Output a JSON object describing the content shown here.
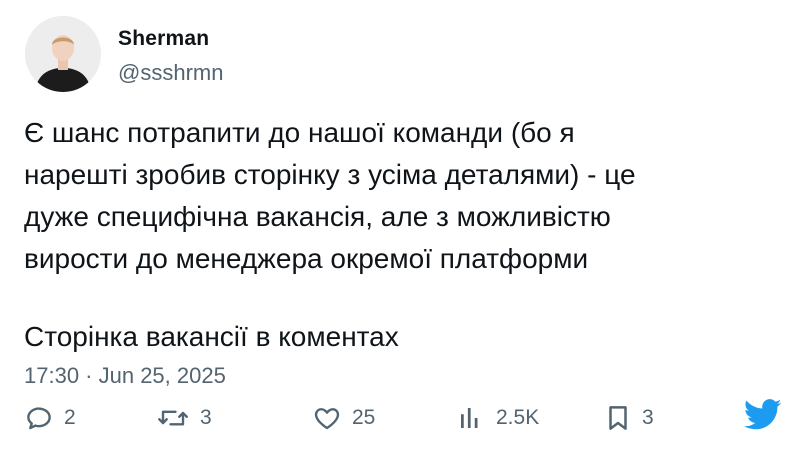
{
  "author": {
    "name": "Sherman",
    "handle": "@ssshrmn"
  },
  "tweet": {
    "lines": [
      "Є шанс потрапити до нашої команди (бо я",
      "нарешті зробив сторінку з усіма деталями) - це",
      "дуже специфічна вакансія, але з можливістю",
      "вирости до менеджера окремої платформи"
    ],
    "second_paragraph": "Сторінка вакансії в коментах",
    "timestamp": "17:30 · Jun 25, 2025"
  },
  "actions": {
    "reply": {
      "icon": "reply-icon",
      "count": "2"
    },
    "retweet": {
      "icon": "retweet-icon",
      "count": "3"
    },
    "like": {
      "icon": "heart-icon",
      "count": "25"
    },
    "views": {
      "icon": "views-icon",
      "count": "2.5K"
    },
    "bookmark": {
      "icon": "bookmark-icon",
      "count": "3"
    }
  },
  "colors": {
    "text": "#0f1419",
    "secondary": "#536471",
    "brand": "#1d9bf0"
  }
}
